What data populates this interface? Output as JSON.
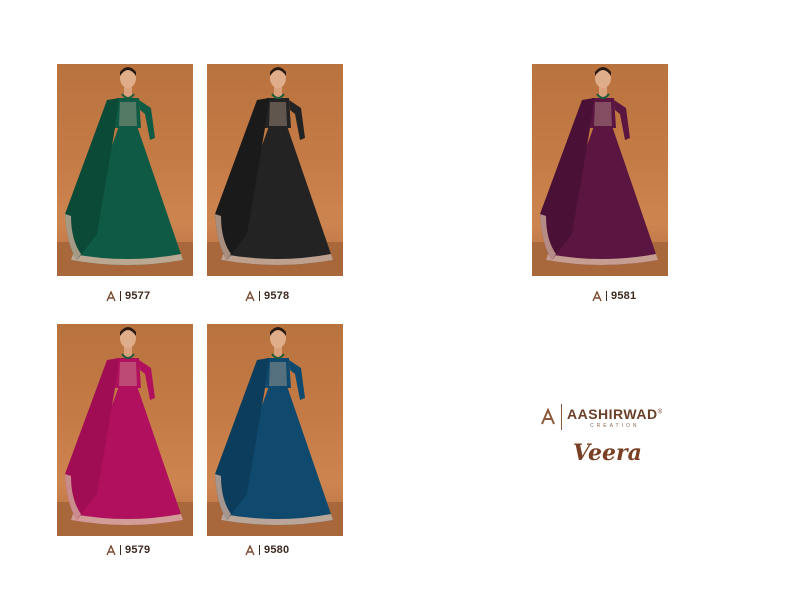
{
  "brand": {
    "name": "AASHIRWAD",
    "trademark": "®",
    "subtitle": "CREATION",
    "logo_icon": "aashirwad-a-logo-icon",
    "colors": {
      "text": "#6b4028",
      "accent": "#7a4025"
    }
  },
  "collection_title": "Veera",
  "catalog": [
    {
      "code": "9577",
      "dress_color": "#0f5a44",
      "dupatta_color": "#0c4a38"
    },
    {
      "code": "9578",
      "dress_color": "#232323",
      "dupatta_color": "#1a1a1a"
    },
    {
      "code": "9581",
      "dress_color": "#5a1540",
      "dupatta_color": "#4a1036"
    },
    {
      "code": "9579",
      "dress_color": "#b0105e",
      "dupatta_color": "#a00d55"
    },
    {
      "code": "9580",
      "dress_color": "#0f4a6e",
      "dupatta_color": "#0c3d5c"
    }
  ],
  "background_color": "#c57b45",
  "trim_color": "#d8b6a0"
}
